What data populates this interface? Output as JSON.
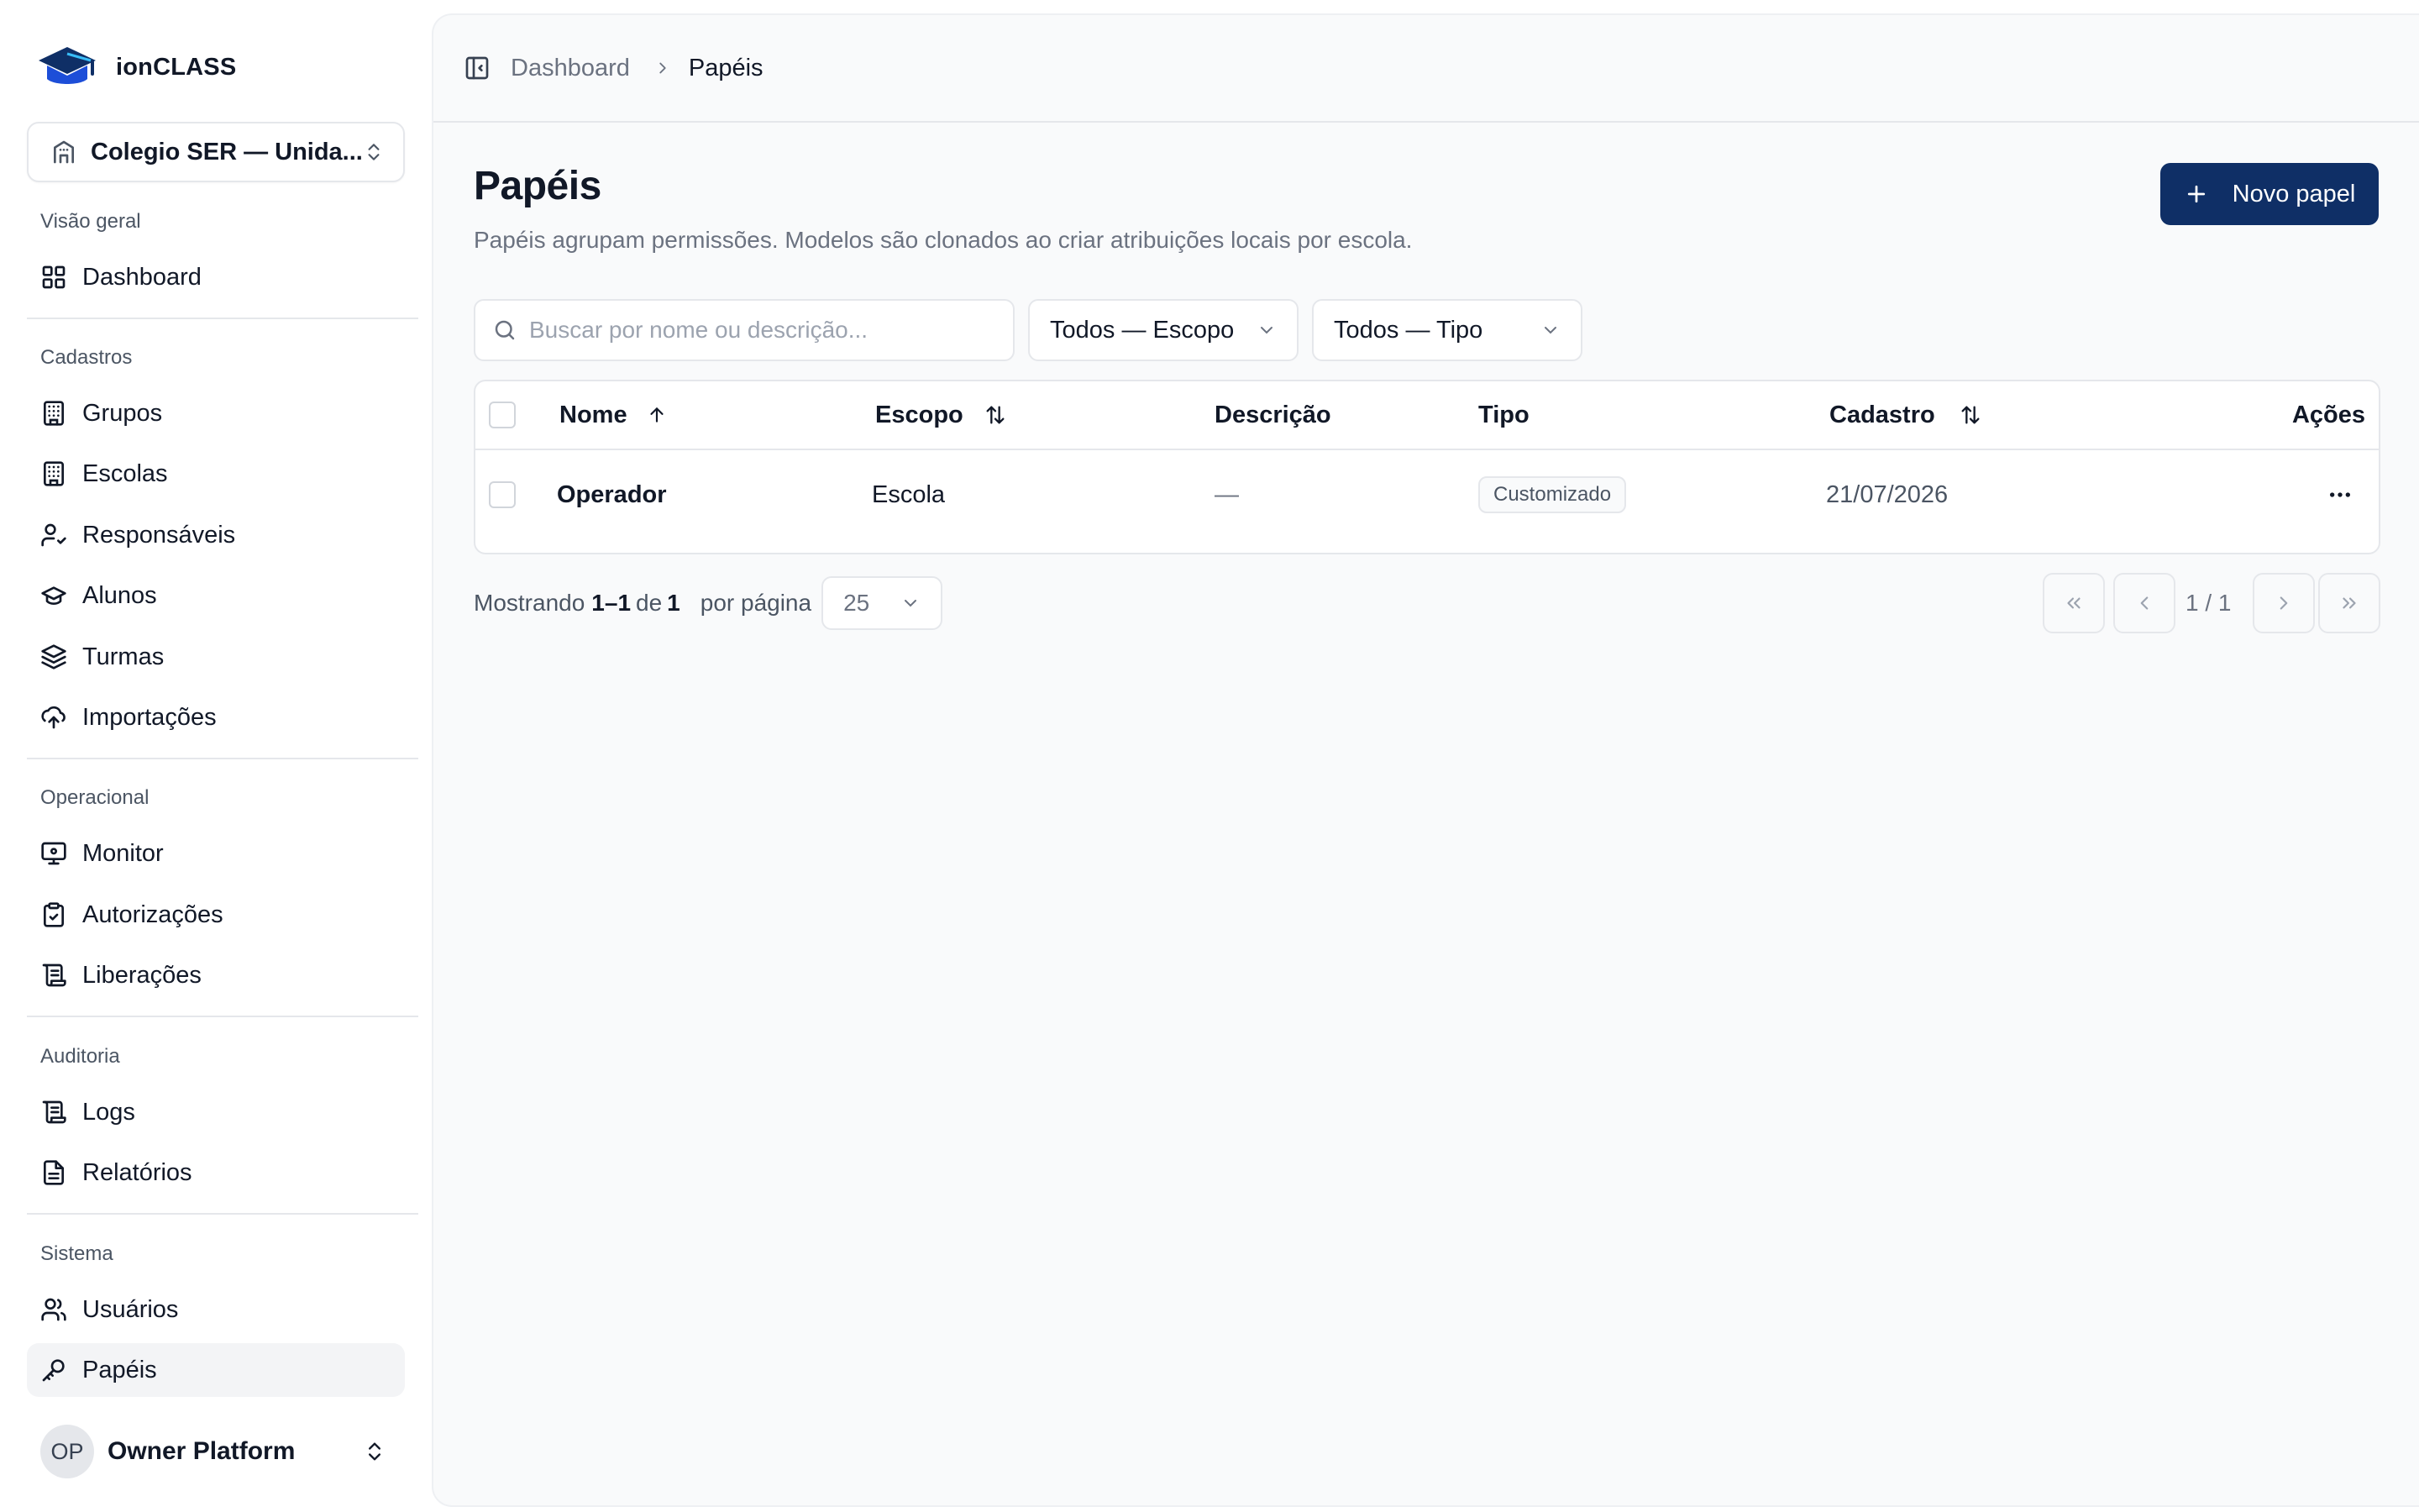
{
  "app": {
    "name": "ionCLASS",
    "accent_color": "#0f2f66"
  },
  "sidebar": {
    "school_selector": {
      "label": "Colegio SER — Unida...",
      "icon": "building-icon"
    },
    "sections": [
      {
        "title": "Visão geral",
        "items": [
          {
            "label": "Dashboard",
            "icon": "grid-icon"
          }
        ]
      },
      {
        "title": "Cadastros",
        "items": [
          {
            "label": "Grupos",
            "icon": "building-icon"
          },
          {
            "label": "Escolas",
            "icon": "building-icon"
          },
          {
            "label": "Responsáveis",
            "icon": "user-check-icon"
          },
          {
            "label": "Alunos",
            "icon": "graduation-cap-icon"
          },
          {
            "label": "Turmas",
            "icon": "layers-icon"
          },
          {
            "label": "Importações",
            "icon": "cloud-upload-icon"
          }
        ]
      },
      {
        "title": "Operacional",
        "items": [
          {
            "label": "Monitor",
            "icon": "monitor-icon"
          },
          {
            "label": "Autorizações",
            "icon": "clipboard-check-icon"
          },
          {
            "label": "Liberações",
            "icon": "scroll-icon"
          }
        ]
      },
      {
        "title": "Auditoria",
        "items": [
          {
            "label": "Logs",
            "icon": "scroll-icon"
          },
          {
            "label": "Relatórios",
            "icon": "file-text-icon"
          }
        ]
      },
      {
        "title": "Sistema",
        "items": [
          {
            "label": "Usuários",
            "icon": "users-icon"
          },
          {
            "label": "Papéis",
            "icon": "key-icon",
            "active": true
          }
        ]
      }
    ],
    "user": {
      "initials": "OP",
      "name": "Owner Platform"
    }
  },
  "breadcrumb": {
    "parent": "Dashboard",
    "current": "Papéis"
  },
  "page": {
    "title": "Papéis",
    "subtitle": "Papéis agrupam permissões. Modelos são clonados ao criar atribuições locais por escola.",
    "new_button": "Novo papel"
  },
  "filters": {
    "search_placeholder": "Buscar por nome ou descrição...",
    "scope": "Todos — Escopo",
    "type": "Todos — Tipo"
  },
  "table": {
    "columns": {
      "name": "Nome",
      "scope": "Escopo",
      "description": "Descrição",
      "type": "Tipo",
      "created": "Cadastro",
      "actions": "Ações"
    },
    "rows": [
      {
        "name": "Operador",
        "scope": "Escola",
        "description": "—",
        "type": "Customizado",
        "created": "21/07/2026"
      }
    ]
  },
  "pagination": {
    "showing_label": "Mostrando",
    "range": "1–1",
    "of_label": "de",
    "total": "1",
    "per_page_label": "por página",
    "per_page": "25",
    "page_indicator": "1 / 1"
  }
}
